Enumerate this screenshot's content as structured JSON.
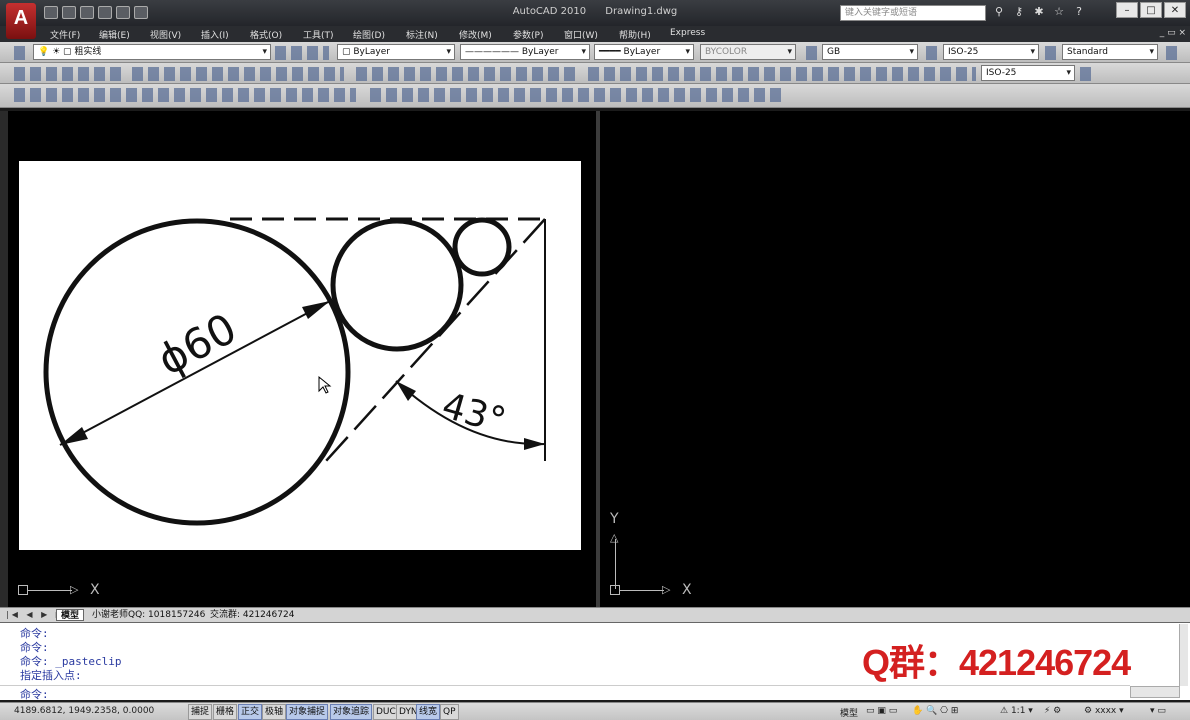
{
  "app": {
    "logo_letter": "A",
    "title_app": "AutoCAD 2010",
    "title_doc": "Drawing1.dwg",
    "search_placeholder": "键入关键字或短语"
  },
  "menu": [
    "文件(F)",
    "编辑(E)",
    "视图(V)",
    "插入(I)",
    "格式(O)",
    "工具(T)",
    "绘图(D)",
    "标注(N)",
    "修改(M)",
    "参数(P)",
    "窗口(W)",
    "帮助(H)",
    "Express"
  ],
  "toolbar1": {
    "layer": "粗实线",
    "color": "ByLayer",
    "linetype": "ByLayer",
    "lineweight": "ByLayer",
    "plotstyle": "BYCOLOR",
    "textstyle": "GB",
    "dimstyle": "ISO-25",
    "tablestyle": "Standard"
  },
  "toolbar2": {
    "dimstyle2": "ISO-25"
  },
  "drawing": {
    "diameter_label": "ϕ60",
    "angle_label": "43°"
  },
  "ucs": {
    "x_label": "X",
    "y_label": "Y"
  },
  "tabs": {
    "nav": "|◀ ◀ ▶ ▶|",
    "model": "模型",
    "layout1": "小谢老师QQ: 1018157246",
    "layout2": "交流群: 421246724"
  },
  "command": {
    "lines": [
      "命令:",
      "命令:",
      "命令: _pasteclip",
      "指定插入点:"
    ],
    "prompt": "命令:",
    "overlay": "Q群：421246724"
  },
  "status": {
    "coords": "4189.6812, 1949.2358, 0.0000",
    "toggles": [
      {
        "label": "捕捉",
        "on": false
      },
      {
        "label": "栅格",
        "on": false
      },
      {
        "label": "正交",
        "on": true
      },
      {
        "label": "极轴",
        "on": false
      },
      {
        "label": "对象捕捉",
        "on": true
      },
      {
        "label": "对象追踪",
        "on": true
      },
      {
        "label": "DUCS",
        "on": false
      },
      {
        "label": "DYN",
        "on": false
      },
      {
        "label": "线宽",
        "on": true
      },
      {
        "label": "QP",
        "on": false
      }
    ],
    "model_label": "模型",
    "scale": "1:1",
    "workspace": "xxxx"
  }
}
